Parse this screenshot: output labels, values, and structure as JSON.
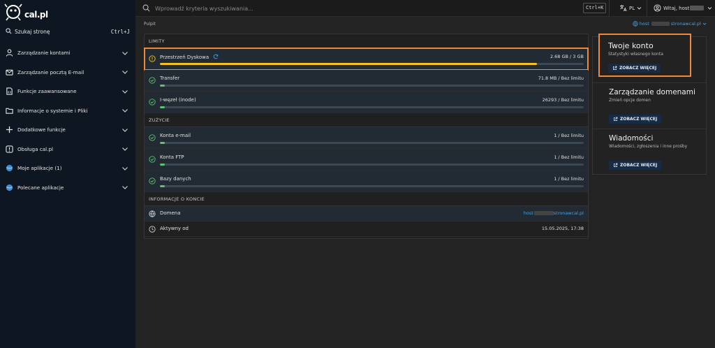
{
  "sidebar": {
    "logo_text": "cal.pl",
    "search_label": "Szukaj stronę",
    "search_shortcut": "Ctrl+J",
    "items": [
      {
        "label": "Zarządzanie kontami",
        "icon": "user-icon"
      },
      {
        "label": "Zarządzanie pocztą E-mail",
        "icon": "mail-icon"
      },
      {
        "label": "Funkcje zaawansowane",
        "icon": "code-file-icon"
      },
      {
        "label": "Informacje o systemie i Pliki",
        "icon": "folder-icon"
      },
      {
        "label": "Dodatkowe funkcje",
        "icon": "plus-icon"
      },
      {
        "label": "Obsługa cal.pl",
        "icon": "alert-icon"
      },
      {
        "label": "Moje aplikacje (1)",
        "icon": "app-globe-icon"
      },
      {
        "label": "Polecane aplikacje",
        "icon": "app-globe-icon"
      }
    ]
  },
  "topbar": {
    "search_placeholder": "Wprowadź kryteria wyszukiwania...",
    "shortcut": "Ctrl+K",
    "lang": "PL",
    "greeting": "Witaj, host"
  },
  "breadcrumb": "Pulpit",
  "domain_link": {
    "prefix": "host",
    "suffix": "stronawcal.pl"
  },
  "limits": {
    "header": "LIMITY",
    "rows": [
      {
        "label": "Przestrzeń Dyskowa",
        "value": "2.68 GB / 3 GB",
        "progress": 0.89,
        "status": "warning"
      },
      {
        "label": "Transfer",
        "value": "71.8 MB / Bez limitu",
        "progress": 0.01,
        "status": "ok"
      },
      {
        "label": "I-węzeł (inode)",
        "value": "26293 / Bez limitu",
        "progress": 0.01,
        "status": "ok"
      }
    ]
  },
  "usage": {
    "header": "ZUŻYCIE",
    "rows": [
      {
        "label": "Konta e-mail",
        "value": "1 / Bez limitu",
        "progress": 0.01,
        "status": "ok"
      },
      {
        "label": "Konta FTP",
        "value": "1 / Bez limitu",
        "progress": 0.01,
        "status": "ok"
      },
      {
        "label": "Bazy danych",
        "value": "1 / Bez limitu",
        "progress": 0.01,
        "status": "ok"
      }
    ]
  },
  "account_info": {
    "header": "INFORMACJE O KONCIE",
    "domain_label": "Domena",
    "domain_prefix": "host",
    "domain_suffix": "stronawcal.pl",
    "active_label": "Aktywny od",
    "active_value": "15.05.2025, 17:38"
  },
  "cards": [
    {
      "title": "Twoje konto",
      "subtitle": "Statystyki własnego konta",
      "button": "ZOBACZ WIĘCEJ"
    },
    {
      "title": "Zarządzanie domenami",
      "subtitle": "Zmień opcje domen",
      "button": "ZOBACZ WIĘCEJ"
    },
    {
      "title": "Wiadomości",
      "subtitle": "Wiadomości, zgłoszenia i inne prośby",
      "button": "ZOBACZ WIĘCEJ"
    }
  ],
  "colors": {
    "accent_orange": "#f0883a",
    "progress_warning": "#f4c21a",
    "progress_ok": "#5ac46e",
    "link": "#4ba3e3",
    "sidebar_bg": "#0e1621"
  }
}
